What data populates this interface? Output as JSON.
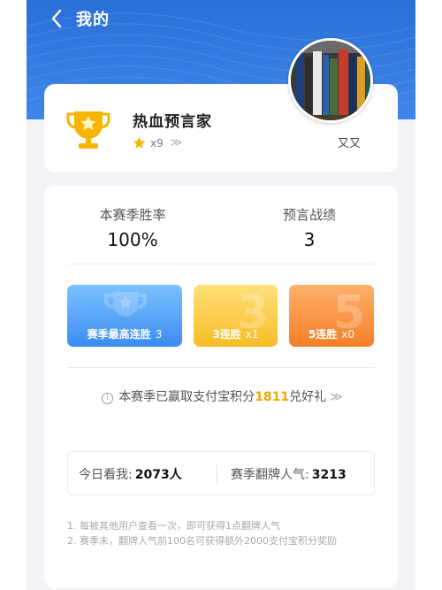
{
  "header": {
    "title": "我的",
    "back_icon": "chevron-left-icon",
    "background_color": "#2f76de"
  },
  "profile": {
    "title": "热血预言家",
    "stars": "x9",
    "stars_chevron": "≫",
    "nickname": "又又",
    "trophy_icon": "trophy-icon",
    "star_icon": "star-icon"
  },
  "stats": {
    "win_rate_label": "本赛季胜率",
    "win_rate_value": "100%",
    "record_label": "预言战绩",
    "record_value": "3"
  },
  "streaks": [
    {
      "label": "赛季最高连胜",
      "value": "3",
      "color": "#3b8cf3"
    },
    {
      "label": "3连胜",
      "value": "x1",
      "color": "#f7bd26"
    },
    {
      "label": "5连胜",
      "value": "x0",
      "color": "#f57f27"
    }
  ],
  "reward": {
    "prefix": "本赛季已赢取支付宝积分",
    "points": "1811",
    "suffix": "兑好礼",
    "chevron": "≫",
    "points_color": "#f0a800"
  },
  "views": {
    "today_label": "今日看我:",
    "today_value": "2073人",
    "popularity_label": "赛季翻牌人气:",
    "popularity_value": "3213"
  },
  "notes": [
    "1. 每被其他用户查看一次，即可获得1点翻牌人气",
    "2. 赛季末，翻牌人气前100名可获得额外2000支付宝积分奖励"
  ]
}
